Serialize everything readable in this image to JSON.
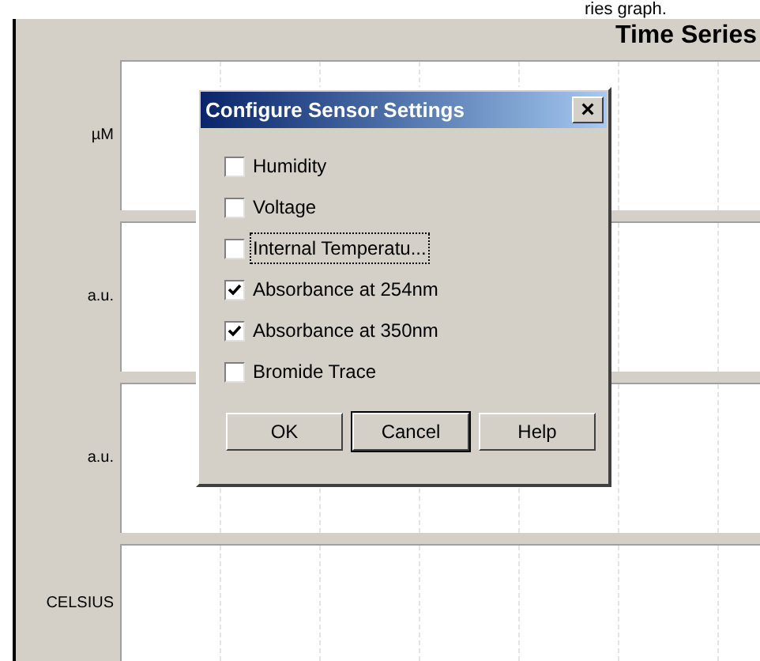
{
  "caption": "ries graph.",
  "panel": {
    "title": "Time Series",
    "plots": [
      {
        "unit": "µM"
      },
      {
        "unit": "a.u."
      },
      {
        "unit": "a.u."
      },
      {
        "unit": "CELSIUS"
      }
    ]
  },
  "dialog": {
    "title": "Configure Sensor Settings",
    "close": "×",
    "options": [
      {
        "label": "Humidity",
        "checked": false,
        "focused": false
      },
      {
        "label": "Voltage",
        "checked": false,
        "focused": false
      },
      {
        "label": "Internal Temperatu...",
        "checked": false,
        "focused": true
      },
      {
        "label": "Absorbance at 254nm",
        "checked": true,
        "focused": false
      },
      {
        "label": "Absorbance at 350nm",
        "checked": true,
        "focused": false
      },
      {
        "label": "Bromide Trace",
        "checked": false,
        "focused": false
      }
    ],
    "buttons": [
      {
        "label": "OK",
        "default": false
      },
      {
        "label": "Cancel",
        "default": true
      },
      {
        "label": "Help",
        "default": false
      }
    ]
  }
}
